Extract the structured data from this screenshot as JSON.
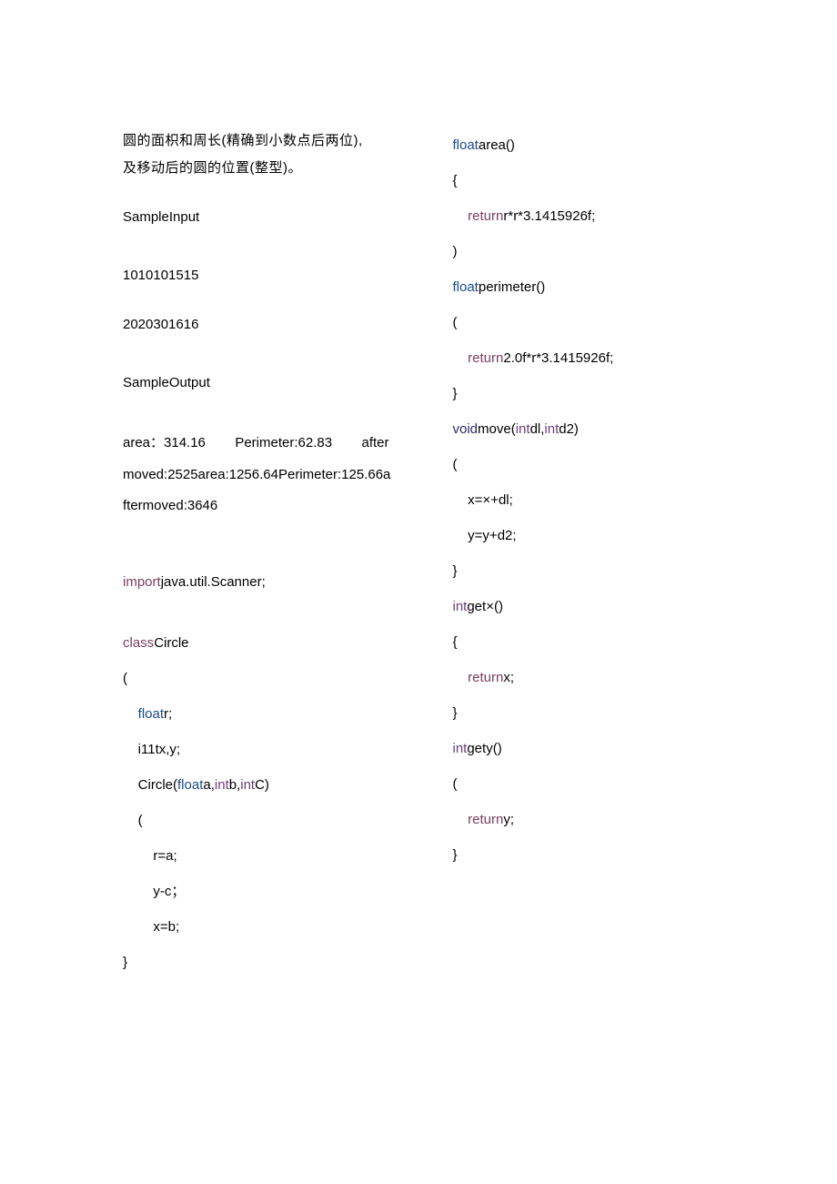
{
  "desc1": "圆的面枳和周长(精确到小数点后两位),",
  "desc2": "及移动后的圆的位置(整型)。",
  "sampleInputLabel": "SampleInput",
  "input1": "1010101515",
  "input2": "2020301616",
  "sampleOutputLabel": "SampleOutput",
  "outputLine1_a": "area：314.16",
  "outputLine1_b": "Perimeter:62.83",
  "outputLine1_c": "after",
  "outputLine2": "moved:2525area:1256.64Perimeter:125.66a",
  "outputLine3": "ftermoved:3646",
  "code": {
    "import_kw": "import",
    "import_rest": "java.util.Scanner;",
    "class_kw": "class",
    "class_name": "Circle",
    "open1": "(",
    "float_kw": "float",
    "r_decl": "r;",
    "int_decl": "i11tx,y;",
    "ctor_name": "Circle(",
    "ctor_p_float": "float",
    "ctor_p_a": "a,",
    "ctor_p_int1": "int",
    "ctor_p_b": "b,",
    "ctor_p_int2": "int",
    "ctor_p_c": "C)",
    "ctor_open": "(",
    "ctor_l1": "r=a;",
    "ctor_l2": "y-c；",
    "ctor_l3": "x=b;",
    "ctor_close": "}",
    "area_sig_float": "float",
    "area_sig_name": "area()",
    "area_open": "{",
    "area_ret_kw": "return",
    "area_ret_expr": "r*r*3.1415926f;",
    "area_close": ")",
    "perim_sig_float": "float",
    "perim_sig_name": "perimeter()",
    "perim_open": "(",
    "perim_ret_kw": "return",
    "perim_ret_expr": "2.0f*r*3.1415926f;",
    "perim_close": "}",
    "move_void": "void",
    "move_name": "move(",
    "move_int1": "int",
    "move_p1": "dl,",
    "move_int2": "int",
    "move_p2": "d2)",
    "move_open": "(",
    "move_l1": "x=×+dl;",
    "move_l2": "y=y+d2;",
    "move_close": "}",
    "getx_int": "int",
    "getx_name": "get×()",
    "getx_open": "{",
    "getx_ret_kw": "return",
    "getx_ret_expr": "x;",
    "getx_close": "}",
    "gety_int": "int",
    "gety_name": "gety()",
    "gety_open": "(",
    "gety_ret_kw": "return",
    "gety_ret_expr": "y;",
    "gety_close": "}"
  }
}
